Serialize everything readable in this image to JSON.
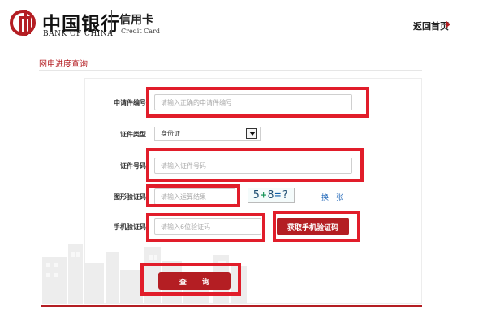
{
  "header": {
    "bank_name_cn": "中国银行",
    "bank_name_en": "BANK OF CHINA",
    "product_cn": "信用卡",
    "product_en": "Credit Card",
    "home_link": "返回首页"
  },
  "section": {
    "title": "网申进度查询"
  },
  "form": {
    "application_number": {
      "label": "申请件编号",
      "placeholder": "请输入正确的申请件编号",
      "value": ""
    },
    "certificate_type": {
      "label": "证件类型",
      "selected": "身份证"
    },
    "certificate_number": {
      "label": "证件号码",
      "placeholder": "请输入证件号码",
      "value": ""
    },
    "graphic_code": {
      "label": "图形验证码",
      "placeholder": "请输入运算结果",
      "value": "",
      "captcha_parts": [
        "5",
        "+",
        "8",
        "=",
        "?"
      ],
      "refresh_label": "换一张"
    },
    "sms_code": {
      "label": "手机验证码",
      "placeholder": "请输入6位验证码",
      "value": "",
      "button_label": "获取手机验证码"
    },
    "submit_label": "查 询"
  },
  "colors": {
    "brand_red": "#b41e23",
    "annotation_red": "#e11d2a",
    "link_blue": "#1d65b7"
  },
  "icons": {
    "logo": "bank-of-china-logo-icon",
    "home_arrow": "triangle-right-icon",
    "select_arrow": "chevron-down-icon",
    "background": "city-skyline-icon"
  }
}
